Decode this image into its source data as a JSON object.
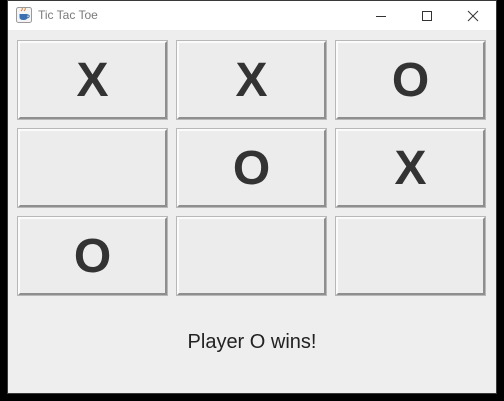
{
  "window": {
    "title": "Tic Tac Toe",
    "icon": "java-cup-icon",
    "controls": [
      "minimize-icon",
      "maximize-icon",
      "close-icon"
    ]
  },
  "board": {
    "cells": [
      "X",
      "X",
      "O",
      "",
      "O",
      "X",
      "O",
      "",
      ""
    ]
  },
  "status": "Player O wins!"
}
